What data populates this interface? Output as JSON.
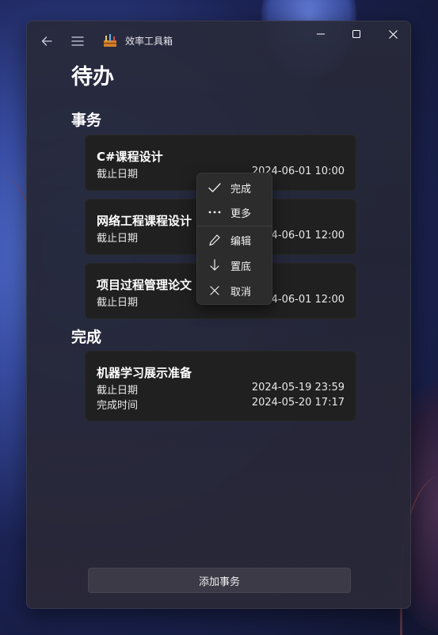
{
  "window": {
    "app_title": "效率工具箱",
    "page_title": "待办"
  },
  "sections": {
    "todo_title": "事务",
    "done_title": "完成"
  },
  "tasks": [
    {
      "title": "C#课程设计",
      "deadline_label": "截止日期",
      "deadline": "2024-06-01 10:00"
    },
    {
      "title": "网络工程课程设计",
      "deadline_label": "截止日期",
      "deadline": "2024-06-01 12:00"
    },
    {
      "title": "项目过程管理论文",
      "deadline_label": "截止日期",
      "deadline": "2024-06-01 12:00"
    }
  ],
  "completed": [
    {
      "title": "机器学习展示准备",
      "deadline_label": "截止日期",
      "deadline": "2024-05-19 23:59",
      "finished_label": "完成时间",
      "finished": "2024-05-20 17:17"
    }
  ],
  "context_menu": {
    "complete": "完成",
    "more": "更多",
    "edit": "编辑",
    "bottom": "置底",
    "cancel": "取消"
  },
  "add_button": "添加事务",
  "icons": [
    "back-arrow-icon",
    "hamburger-menu-icon",
    "toolbox-app-icon",
    "minimize-icon",
    "maximize-icon",
    "close-icon",
    "checkmark-icon",
    "more-dots-icon",
    "pencil-icon",
    "down-arrow-icon",
    "x-icon"
  ]
}
